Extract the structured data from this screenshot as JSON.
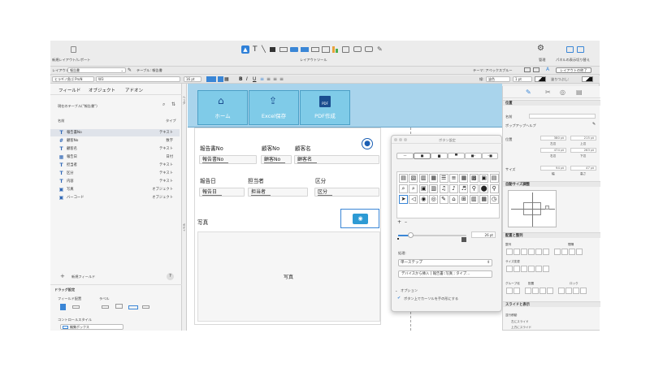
{
  "toolbar": {
    "left_label": "新規レイアウト/レポート",
    "center_label": "レイアウトツール",
    "right_labels": [
      "管理",
      "パネルの表示切り替え"
    ],
    "layout_label": "レイアウト:",
    "layout_value": "報告書",
    "table_label": "テーブル: 報告書",
    "theme_label": "テーマ: アペックスブルー",
    "exit_button": "レイアウトの終了"
  },
  "format_bar": {
    "font": "ヒラギノ角ゴ ProN",
    "weight": "W3",
    "size": "16 pt",
    "style_labels": [
      "B",
      "I",
      "U"
    ],
    "line_label": "線:",
    "line_value": "塗色",
    "line_width": "1 pt",
    "fill_label": "塗りつぶし:"
  },
  "sidebar": {
    "tabs": [
      "フィールド",
      "オブジェクト",
      "アドオン"
    ],
    "table_select": "現在のテーブル(\"報告書\")",
    "col_name": "名前",
    "col_type": "タイプ",
    "fields": [
      {
        "icon": "T",
        "name": "報告書No",
        "type": "テキスト"
      },
      {
        "icon": "#",
        "name": "顧客No",
        "type": "数字"
      },
      {
        "icon": "T",
        "name": "顧客名",
        "type": "テキスト"
      },
      {
        "icon": "▦",
        "name": "報告日",
        "type": "日付"
      },
      {
        "icon": "T",
        "name": "担当者",
        "type": "テキスト"
      },
      {
        "icon": "T",
        "name": "区分",
        "type": "テキスト"
      },
      {
        "icon": "T",
        "name": "内容",
        "type": "テキスト"
      },
      {
        "icon": "▣",
        "name": "写真",
        "type": "オブジェクト"
      },
      {
        "icon": "▣",
        "name": "バーコード",
        "type": "オブジェクト"
      }
    ],
    "new_field": "新規フィールド",
    "help": "?",
    "drag_settings": "ドラッグ設定",
    "field_placement": "フィールド配置",
    "label": "ラベル",
    "control_style": "コントロールスタイル",
    "control_value": "編集ボックス"
  },
  "layout": {
    "part_labels": [
      "ヘッダ",
      "ボディ"
    ],
    "nav_buttons": [
      {
        "icon": "home-icon",
        "label": "ホーム"
      },
      {
        "icon": "upload-icon",
        "label": "Excel保存"
      },
      {
        "icon": "pdf-icon",
        "label": "PDF作成"
      }
    ],
    "pdf_badge": "PDF",
    "fields": {
      "report_no_label": "報告書No",
      "report_no_value": "報告書No",
      "customer_no_label": "顧客No",
      "customer_no_value": "顧客No",
      "customer_name_label": "顧客名",
      "customer_name_value": "顧客名",
      "report_date_label": "報告日",
      "report_date_value": "報告日",
      "staff_label": "担当者",
      "staff_value": "担当者",
      "category_label": "区分",
      "category_value": "区分",
      "photo_label": "写真",
      "photo_value": "写真"
    }
  },
  "palette": {
    "title": "ボタン設定",
    "size_value": "26 pt",
    "action_label": "処理:",
    "action_value": "単一ステップ",
    "action_detail": "デバイスから挿入 [ 報告書::写真 ; タイプ...",
    "options_label": "オプション",
    "option_checkbox": "ボタン上でカーソルを手の形にする"
  },
  "inspector": {
    "position_section": "位置",
    "name_label": "名前",
    "tooltip_label": "ポップアップヘルプ",
    "position_label": "位置",
    "left": "380",
    "top": "215",
    "right": "474",
    "bottom": "263",
    "left_caption": "左辺",
    "top_caption": "上辺",
    "right_caption": "右辺",
    "bottom_caption": "下辺",
    "unit": "pt",
    "size_label": "サイズ",
    "width": "94",
    "height": "47",
    "width_caption": "幅",
    "height_caption": "高さ",
    "autosize_section": "自動サイズ調整",
    "arrange_section": "配置と整列",
    "align_label": "整列",
    "distribute_label": "間隔",
    "resize_label": "サイズ変更",
    "group_label": "グループ化",
    "arrange_label": "配置",
    "lock_label": "ロック",
    "slide_section": "スライドと表示",
    "slide_label": "並行移動",
    "slide_left": "左にスライド",
    "slide_up": "上方にスライド"
  },
  "colors": {
    "accent": "#3a86d6",
    "nav_button": "#7fcbe8",
    "header_band": "#a9d4ec"
  }
}
